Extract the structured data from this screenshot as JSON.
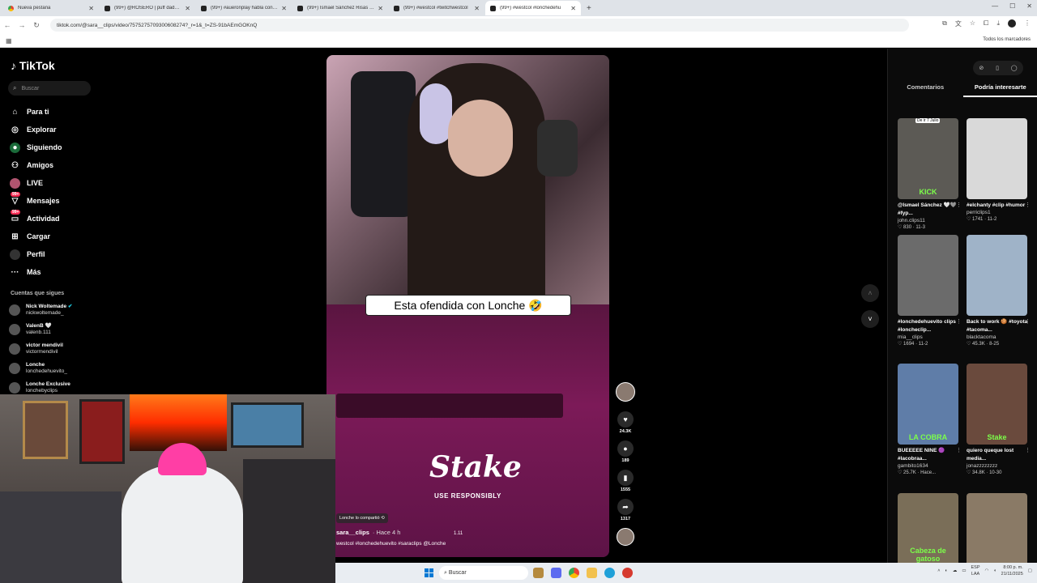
{
  "browser": {
    "tabs": [
      {
        "title": "Nueva pestaña",
        "active": false,
        "icon": "chrome-icon"
      },
      {
        "title": "(99+) @ROSERO | puff daddy ! |",
        "active": false,
        "icon": "tiktok-icon"
      },
      {
        "title": "(99+) #aueronplay habla con sar",
        "active": false,
        "icon": "tiktok-icon"
      },
      {
        "title": "(99+) Ismael Sánchez Risas y D",
        "active": false,
        "icon": "tiktok-icon"
      },
      {
        "title": "(99+) #westcol #twitchwestcol",
        "active": false,
        "icon": "tiktok-icon"
      },
      {
        "title": "(99+) #westcol #lonchedehu",
        "active": true,
        "icon": "tiktok-icon"
      }
    ],
    "url": "tiktok.com/@sara__clips/video/7575275709300608274?_r=1&_t=ZS-91bAEmGOKnQ",
    "all_bookmarks": "Todos los marcadores"
  },
  "tiktok": {
    "logo": "TikTok",
    "search_placeholder": "Buscar",
    "nav": [
      {
        "label": "Para ti",
        "icon": "home-icon"
      },
      {
        "label": "Explorar",
        "icon": "compass-icon"
      },
      {
        "label": "Siguiendo",
        "icon": "following-icon"
      },
      {
        "label": "Amigos",
        "icon": "friends-icon"
      },
      {
        "label": "LIVE",
        "icon": "live-icon"
      },
      {
        "label": "Mensajes",
        "icon": "messages-icon",
        "badge": "99+"
      },
      {
        "label": "Actividad",
        "icon": "activity-icon",
        "badge": "99+"
      },
      {
        "label": "Cargar",
        "icon": "upload-icon"
      },
      {
        "label": "Perfil",
        "icon": "profile-icon"
      },
      {
        "label": "Más",
        "icon": "more-icon"
      }
    ],
    "following_title": "Cuentas que sigues",
    "following": [
      {
        "name": "Nick Woltemade",
        "handle": "nickwoltemade_"
      },
      {
        "name": "ValenB 🤍",
        "handle": "valenb.111"
      },
      {
        "name": "victor mendivil",
        "handle": "victormendivil"
      },
      {
        "name": "Lonche",
        "handle": "lonchedehuevito_"
      },
      {
        "name": "Lonche Exclusive",
        "handle": "lonchebyclips"
      }
    ]
  },
  "video": {
    "caption": "Esta ofendida con Lonche 🤣",
    "sponsor": "Stake",
    "sponsor_sub": "USE RESPONSIBLY",
    "shared_by": "Lonche lo compartió",
    "author": "sara__clips",
    "posted": "· Hace 4 h",
    "description": "westcol #lonchedehuevito #saraclips @Lonche",
    "stamp": "1.11",
    "likes": "24.3K",
    "comments": "189",
    "saves": "1555",
    "shares": "1317"
  },
  "right_panel": {
    "tabs": [
      "Comentarios",
      "Podría interesarte"
    ],
    "active_tab": 1,
    "cards": [
      {
        "title": "@Ismael Sánchez 🤍🩶 #fyp...",
        "user": "john.clips11",
        "likes": "830",
        "date": "11-3",
        "badge": "De ir 7 Julio",
        "thumb_label": "KICK",
        "color": "#5c5a55"
      },
      {
        "title": "#elchanty #clip #humor",
        "user": "perriclips1",
        "likes": "1741",
        "date": "11-2",
        "badge": "",
        "thumb_label": "",
        "color": "#d9d9d9"
      },
      {
        "title": "#lonchedehuevito clips #loncheclip...",
        "user": "mia__clips",
        "likes": "1694",
        "date": "11-2",
        "badge": "",
        "thumb_label": "",
        "color": "#6b6b6b"
      },
      {
        "title": "Back to work 🍪 #toyota #tacoma...",
        "user": "blacktacoma",
        "likes": "45.3K",
        "date": "8-25",
        "badge": "",
        "thumb_label": "",
        "color": "#9fb3c8"
      },
      {
        "title": "BUEEEEE NINE 🟣 #lacobraa...",
        "user": "gambito1634",
        "likes": "25.7K",
        "date": "Hace...",
        "badge": "",
        "thumb_label": "LA COBRA",
        "color": "#5f7da8"
      },
      {
        "title": "quiero queque lost media...",
        "user": "jonazzzzzzzz",
        "likes": "34.8K",
        "date": "10-30",
        "badge": "",
        "thumb_label": "Stake",
        "color": "#6a4a3d"
      },
      {
        "title": "",
        "user": "",
        "likes": "",
        "date": "",
        "badge": "",
        "thumb_label": "Cabeza de gatoso representando",
        "color": "#7a6e58"
      },
      {
        "title": "",
        "user": "",
        "likes": "",
        "date": "",
        "badge": "",
        "thumb_label": "",
        "color": "#8a7a66"
      }
    ]
  },
  "taskbar": {
    "search_placeholder": "Buscar",
    "lang": "ESP",
    "lang_sub": "LAA",
    "time": "8:00 p. m.",
    "date": "21/11/2025"
  }
}
